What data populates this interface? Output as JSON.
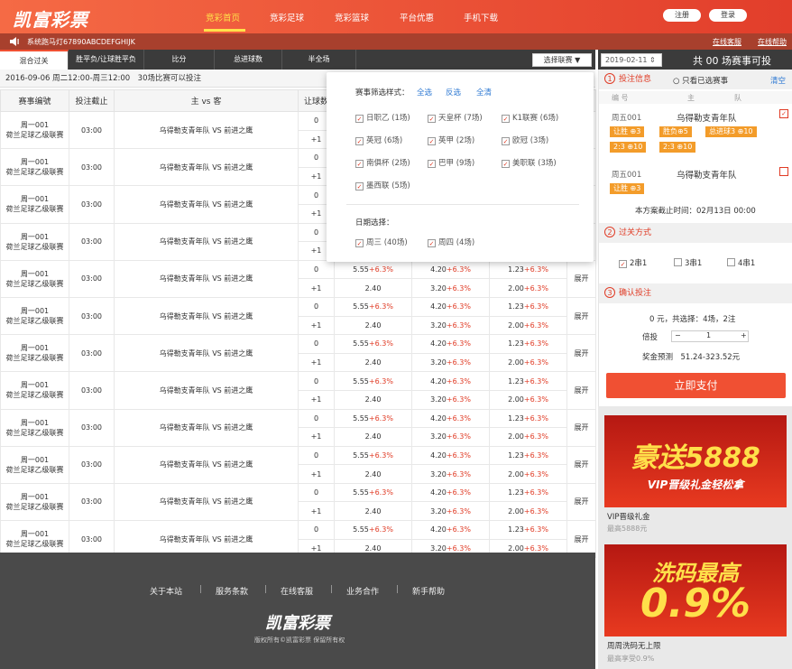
{
  "header": {
    "logo": "凯富彩票",
    "nav": [
      "竞彩首页",
      "竞彩足球",
      "竞彩篮球",
      "平台优惠",
      "手机下载"
    ],
    "register": "注册",
    "login": "登录"
  },
  "notice": {
    "marquee": "系统跑马灯67890ABCDEFGHIJK",
    "service": "在线客服",
    "client": "在线帮助"
  },
  "tabs": [
    "混合过关",
    "胜平负/让球胜平负",
    "比分",
    "总进球数",
    "半全场"
  ],
  "filter_label": "选择联赛 ▼",
  "date_value": "2019-02-11 ⇕",
  "total": "共 00 场赛事可投",
  "info": "2016-09-06 周二12:00-周三12:00　30场比赛可以投注",
  "table": {
    "headers": [
      "赛事编號",
      "投注截止",
      "主 vs 客",
      "让球数"
    ],
    "row": {
      "no": "周一001",
      "league": "荷兰足球乙级联赛",
      "time": "03:00",
      "match": "乌得勒支青年队 VS 前进之鹰",
      "h0": "0",
      "h1": "+1",
      "o1": "5.55",
      "o1c": "+6.3%",
      "o2": "4.20",
      "o2c": "+6.3%",
      "o3": "1.23",
      "o3c": "+6.3%",
      "p1": "2.40",
      "p2": "3.20",
      "p2c": "+6.3%",
      "p3": "2.00",
      "p3c": "+6.3%",
      "more": "展开"
    }
  },
  "overlay": {
    "title": "赛事筛选样式：",
    "all": "全选",
    "invert": "反选",
    "clear": "全清",
    "leagues": [
      "日职乙 (1场)",
      "天皇杯 (7场)",
      "K1联赛 (6场)",
      "英冠 (6场)",
      "英甲 (2场)",
      "欧冠 (3场)",
      "南俱杯 (2场)",
      "巴甲 (9场)",
      "美职联 (3场)",
      "墨西联 (5场)"
    ],
    "date_title": "日期选择：",
    "dates": [
      "周三 (40场)",
      "周四 (4场)"
    ]
  },
  "side": {
    "step1": "投注信息",
    "only": "只看已选赛事",
    "clear": "清空",
    "cols": [
      "编 号",
      "主",
      "队"
    ],
    "m1": {
      "no": "周五001",
      "team": "乌得勒支青年队",
      "tags": [
        "让胜 ⊕3",
        "胜负⊕5",
        "总进球3 ⊕10",
        "2:3 ⊕10",
        "2:3 ⊕10"
      ]
    },
    "m2": {
      "no": "周五001",
      "team": "乌得勒支青年队",
      "tags": [
        "让胜 ⊕3"
      ]
    },
    "deadline": "本方案截止时间：02月13日 00:00",
    "step2": "过关方式",
    "pass": [
      "2串1",
      "3串1",
      "4串1"
    ],
    "step3": "确认投注",
    "summary": "0 元，共选择：4场，2注",
    "mult_label": "倍投",
    "mult": "1",
    "prize": "奖金预测　51.24-323.52元",
    "pay": "立即支付"
  },
  "ads": [
    {
      "big": "豪送5888",
      "sub": "VIP晋级礼金轻松拿",
      "cap": "VIP晋级礼金",
      "cap2": "最高5888元"
    },
    {
      "big": "洗码最高",
      "pct": "0.9%",
      "cap": "周周洗码无上限",
      "cap2": "最高享受0.9%"
    }
  ],
  "footer": {
    "links": [
      "关于本站",
      "服务条款",
      "在线客服",
      "业务合作",
      "新手帮助"
    ],
    "logo": "凯富彩票",
    "copy": "版权所有©凯富彩票 保留所有权"
  },
  "colors": {
    "brand": "#e23e2b",
    "accent": "#f05033",
    "tag": "#f39c2a"
  }
}
